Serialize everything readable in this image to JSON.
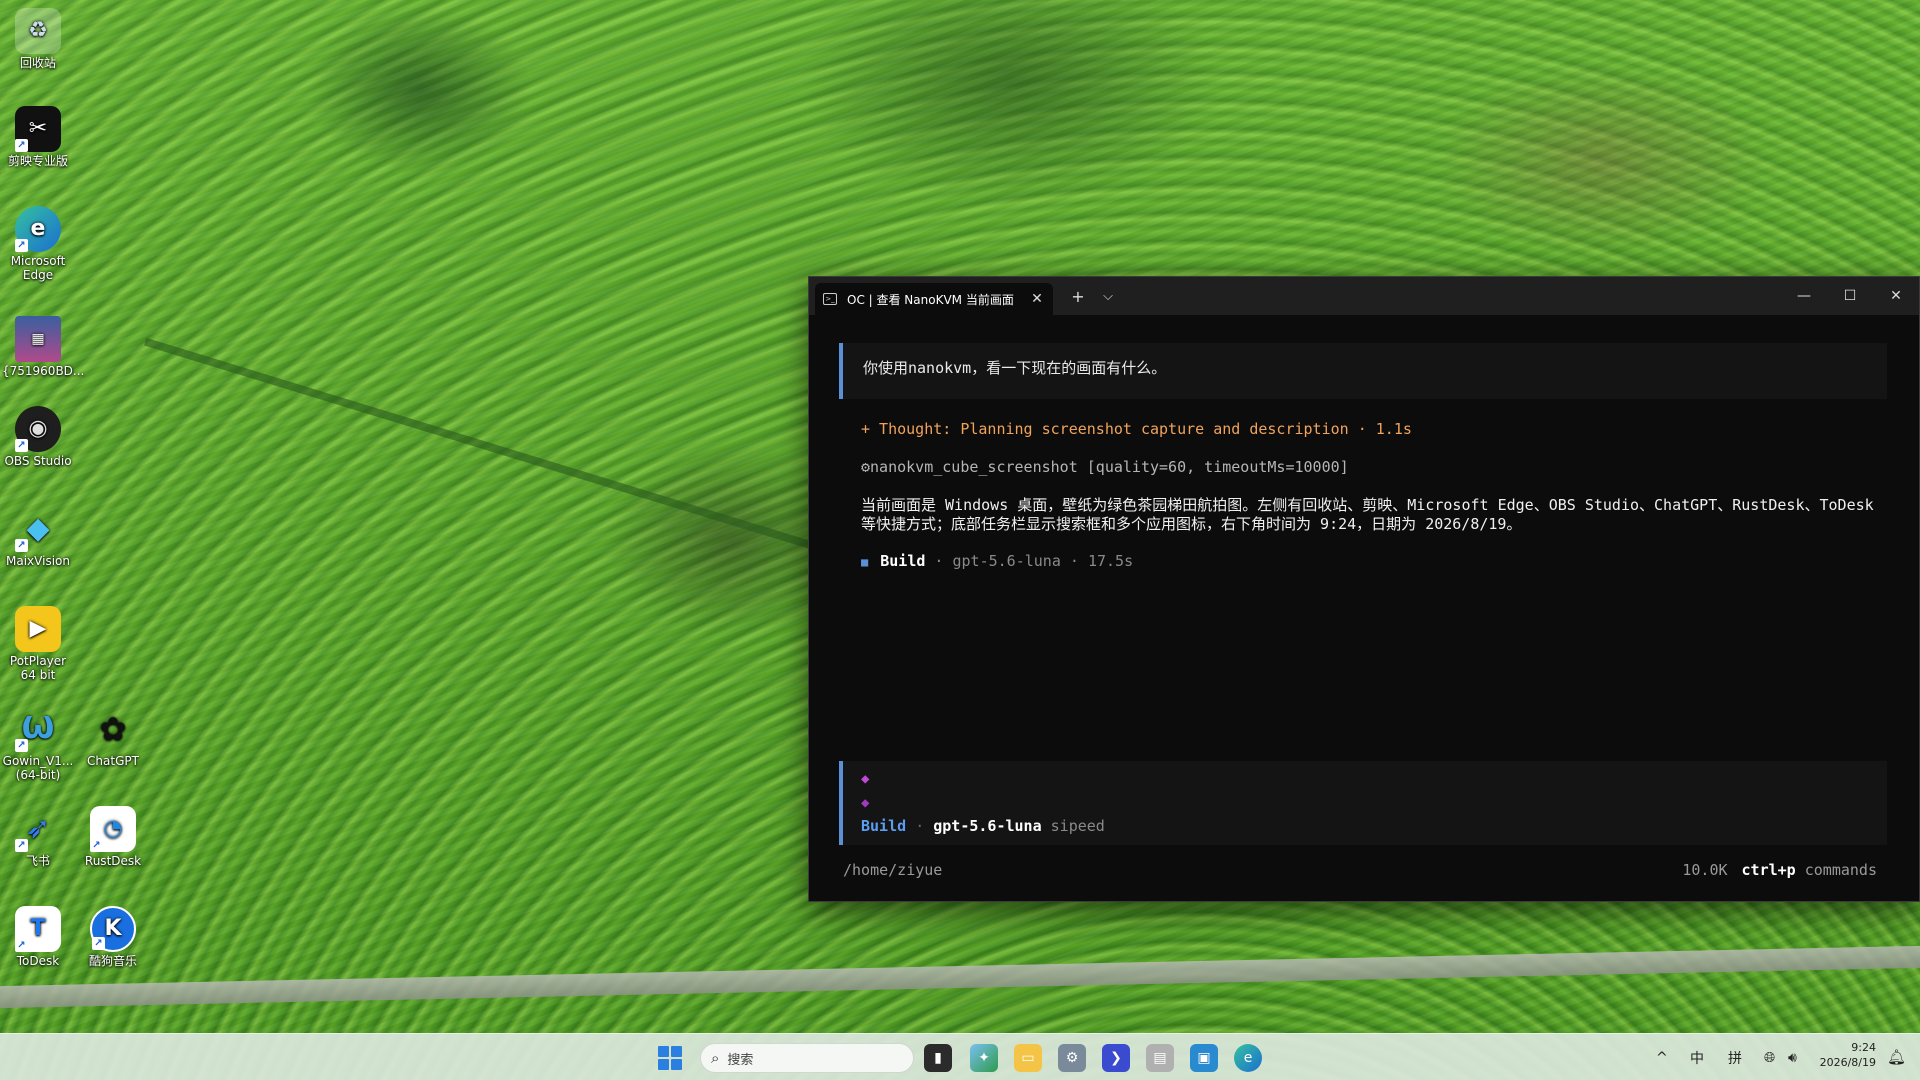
{
  "desktop": {
    "icons": [
      {
        "label": "回收站",
        "icon": "recycle-bin-icon"
      },
      {
        "label": "剪映专业版",
        "icon": "capcut-icon"
      },
      {
        "label": "Microsoft Edge",
        "icon": "edge-icon"
      },
      {
        "label": "{751960BD...",
        "icon": "image-file-icon"
      },
      {
        "label": "OBS Studio",
        "icon": "obs-icon"
      },
      {
        "label": "MaixVision",
        "icon": "maixvision-icon"
      },
      {
        "label": "PotPlayer 64 bit",
        "icon": "potplayer-icon"
      },
      {
        "label": "Gowin_V1... (64-bit)",
        "icon": "gowin-icon"
      },
      {
        "label": "ChatGPT",
        "icon": "chatgpt-icon"
      },
      {
        "label": "飞书",
        "icon": "feishu-icon"
      },
      {
        "label": "RustDesk",
        "icon": "rustdesk-icon"
      },
      {
        "label": "ToDesk",
        "icon": "todesk-icon"
      },
      {
        "label": "酷狗音乐",
        "icon": "kugou-icon"
      }
    ]
  },
  "terminal": {
    "tab_title": "OC | 查看 NanoKVM 当前画面",
    "new_tab": "+",
    "dropdown": "⌵",
    "user_message": "你使用nanokvm，看一下现在的画面有什么。",
    "thought": "+ Thought: Planning screenshot capture and description · 1.1s",
    "tool_call": "⚙nanokvm_cube_screenshot [quality=60, timeoutMs=10000]",
    "answer": "当前画面是 Windows 桌面，壁纸为绿色茶园梯田航拍图。左侧有回收站、剪映、Microsoft Edge、OBS Studio、ChatGPT、RustDesk、ToDesk 等快捷方式；底部任务栏显示搜索框和多个应用图标，右下角时间为 9:24，日期为 2026/8/19。",
    "build": {
      "mark": "■",
      "name": "Build",
      "sep": "·",
      "model": "gpt-5.6-luna",
      "time": "17.5s"
    },
    "input": {
      "mode": "Build",
      "sep": "·",
      "model": "gpt-5.6-luna",
      "provider": "sipeed"
    },
    "footer": {
      "path": "/home/ziyue",
      "tokens": "10.0K",
      "key": "ctrl+p",
      "key_label": "commands"
    }
  },
  "taskbar": {
    "search_placeholder": "搜索",
    "tray": {
      "chevron": "^",
      "ime1": "中",
      "ime2": "拼"
    },
    "time": "9:24",
    "date": "2026/8/19"
  }
}
